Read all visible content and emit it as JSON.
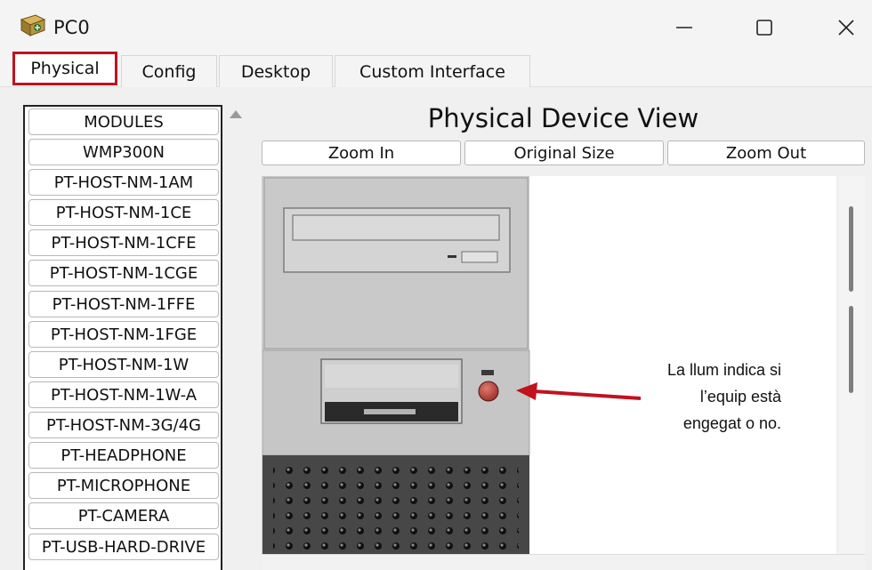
{
  "window": {
    "title": "PC0",
    "icon": "packet-tracer-pc-icon"
  },
  "tabs": [
    {
      "label": "Physical",
      "active": true
    },
    {
      "label": "Config",
      "active": false
    },
    {
      "label": "Desktop",
      "active": false
    },
    {
      "label": "Custom Interface",
      "active": false
    }
  ],
  "modules": {
    "items": [
      "MODULES",
      "WMP300N",
      "PT-HOST-NM-1AM",
      "PT-HOST-NM-1CE",
      "PT-HOST-NM-1CFE",
      "PT-HOST-NM-1CGE",
      "PT-HOST-NM-1FFE",
      "PT-HOST-NM-1FGE",
      "PT-HOST-NM-1W",
      "PT-HOST-NM-1W-A",
      "PT-HOST-NM-3G/4G",
      "PT-HEADPHONE",
      "PT-MICROPHONE",
      "PT-CAMERA",
      "PT-USB-HARD-DRIVE"
    ]
  },
  "physical_view": {
    "title": "Physical Device View",
    "zoom_in": "Zoom In",
    "original_size": "Original Size",
    "zoom_out": "Zoom Out"
  },
  "annotation": {
    "line1": "La llum indica si",
    "line2": "l’equip està",
    "line3": "engegat o no."
  },
  "colors": {
    "highlight": "#c0121f",
    "power_led": "#b8403a"
  }
}
